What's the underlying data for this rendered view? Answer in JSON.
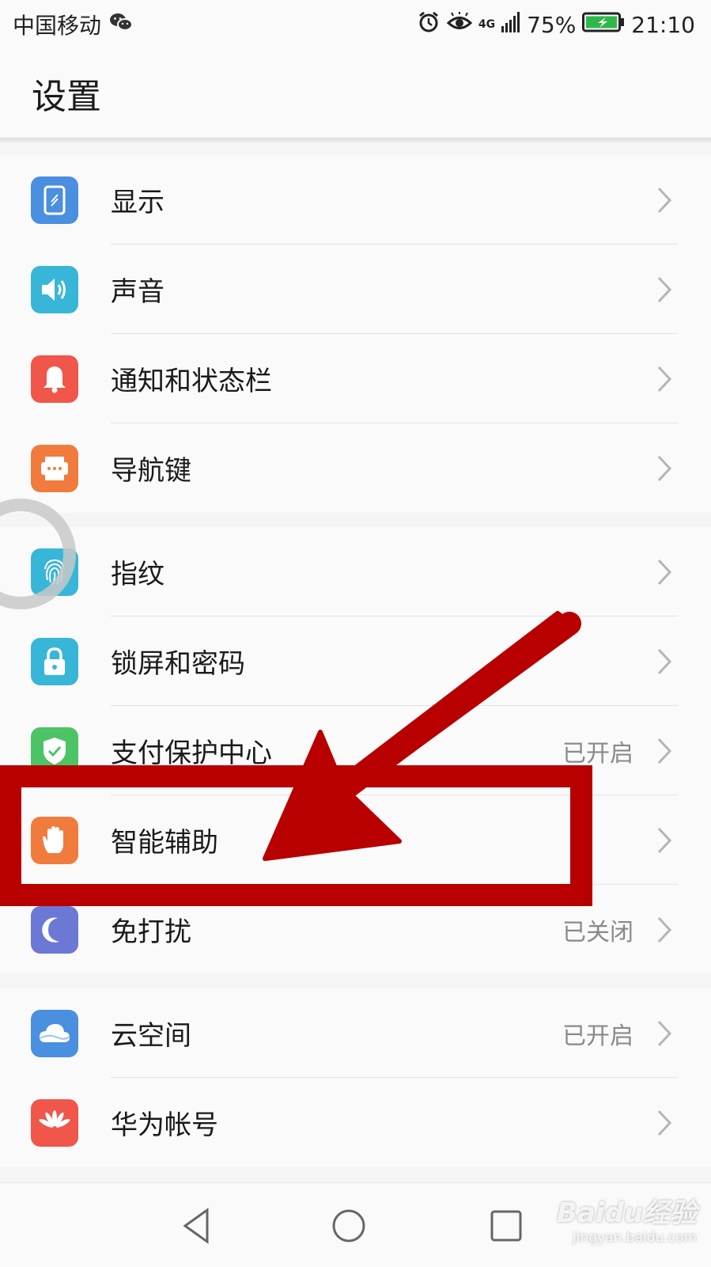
{
  "status_bar": {
    "carrier": "中国移动",
    "network": "4G",
    "battery": "75%",
    "time": "21:10",
    "icons": [
      "wechat-icon",
      "alarm-icon",
      "eye-comfort-icon",
      "signal-icon",
      "battery-icon"
    ]
  },
  "header": {
    "title": "设置"
  },
  "groups": [
    {
      "items": [
        {
          "label": "显示",
          "icon": "display-icon",
          "color": "#4a8fe0"
        },
        {
          "label": "声音",
          "icon": "sound-icon",
          "color": "#38b6d8"
        },
        {
          "label": "通知和状态栏",
          "icon": "bell-icon",
          "color": "#f0564a"
        },
        {
          "label": "导航键",
          "icon": "navigation-key-icon",
          "color": "#f07b3c"
        }
      ]
    },
    {
      "items": [
        {
          "label": "指纹",
          "icon": "fingerprint-icon",
          "color": "#38b6d8"
        },
        {
          "label": "锁屏和密码",
          "icon": "lock-icon",
          "color": "#38b6d8"
        },
        {
          "label": "支付保护中心",
          "value": "已开启",
          "icon": "shield-check-icon",
          "color": "#4cc466"
        },
        {
          "label": "智能辅助",
          "icon": "hand-icon",
          "color": "#f07b3c"
        },
        {
          "label": "免打扰",
          "value": "已关闭",
          "icon": "moon-icon",
          "color": "#6b78d6"
        }
      ]
    },
    {
      "items": [
        {
          "label": "云空间",
          "value": "已开启",
          "icon": "cloud-icon",
          "color": "#4a8fe0"
        },
        {
          "label": "华为帐号",
          "icon": "huawei-logo-icon",
          "color": "#f0564a"
        }
      ]
    }
  ],
  "navigation_bar": {
    "buttons": [
      "back-icon",
      "home-icon",
      "recents-icon"
    ]
  },
  "annotation": {
    "color": "#b80000",
    "highlighted_item": "智能辅助"
  },
  "watermark": {
    "main": "Baidu经验",
    "sub": "jingyan.baidu.com"
  }
}
